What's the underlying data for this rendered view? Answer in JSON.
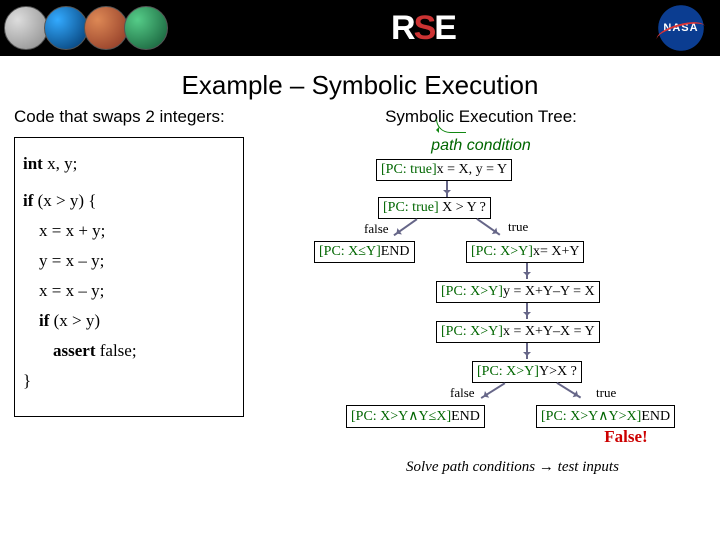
{
  "banner": {
    "rse_r": "R",
    "rse_s": "S",
    "rse_e": "E",
    "nasa": "NASA"
  },
  "title": "Example – Symbolic Execution",
  "left_heading": "Code that swaps 2 integers:",
  "right_heading": "Symbolic Execution Tree:",
  "path_condition_label": "path condition",
  "code": {
    "l1a": "int",
    "l1b": " x, y;",
    "l2a": "if",
    "l2b": " (x > y) {",
    "l3": "x = x + y;",
    "l4": "y = x – y;",
    "l5": "x = x – y;",
    "l6a": "if",
    "l6b": " (x > y)",
    "l7a": "assert",
    "l7b": " false;",
    "l8": "}"
  },
  "tree": {
    "n1_pc": "[PC: true]",
    "n1_rest": "x = X, y = Y",
    "n2_pc": "[PC: true]",
    "n2_rest": " X > Y ?",
    "false": "false",
    "true": "true",
    "n3_pc": "[PC: X≤Y]",
    "n3_rest": "END",
    "n4_pc": "[PC: X>Y]",
    "n4_rest": "x= X+Y",
    "n5_pc": "[PC: X>Y]",
    "n5_rest": "y = X+Y–Y = X",
    "n6_pc": "[PC: X>Y]",
    "n6_rest": "x = X+Y–X = Y",
    "n7_pc": "[PC: X>Y]",
    "n7_rest": "Y>X ?",
    "n8_pc": "[PC: X>Y∧Y≤X]",
    "n8_rest": "END",
    "n9_pc": "[PC: X>Y∧Y>X]",
    "n9_rest": "END",
    "false_text": "False!",
    "footer": "Solve path conditions → test inputs"
  }
}
